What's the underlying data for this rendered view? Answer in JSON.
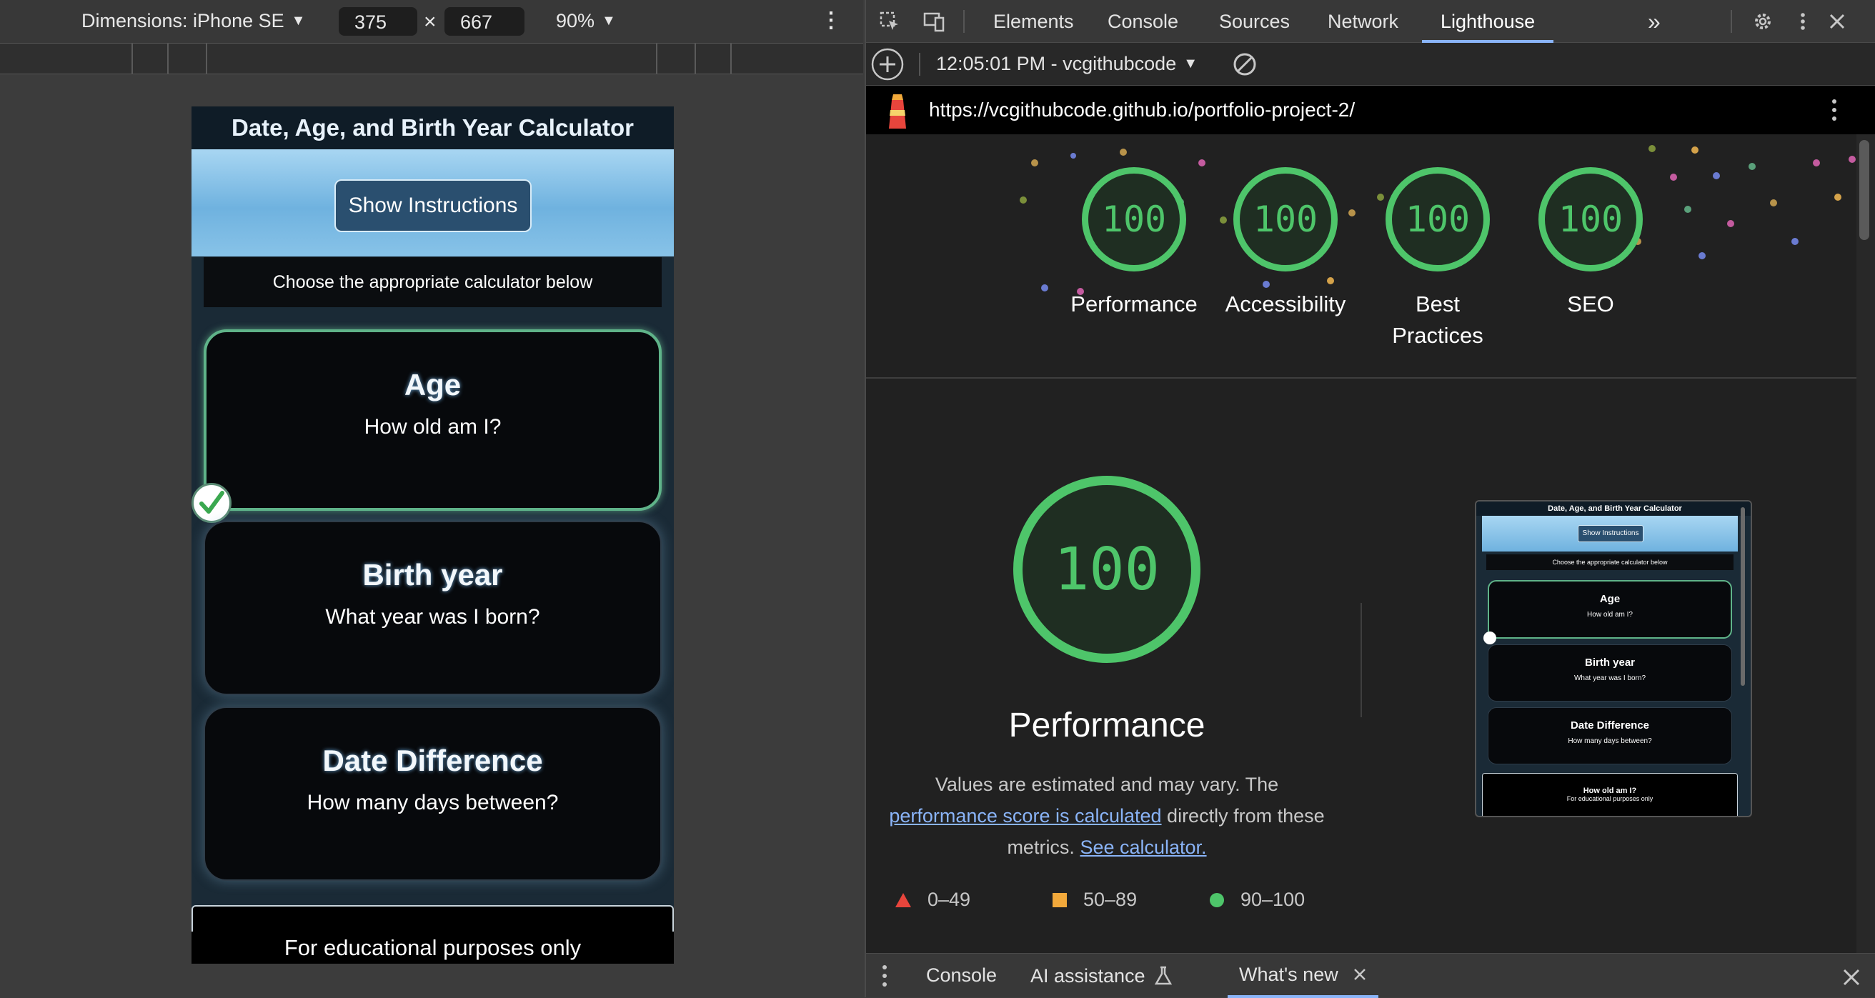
{
  "device_toolbar": {
    "dimensions_label": "Dimensions: iPhone SE",
    "width": "375",
    "height": "667",
    "times": "×",
    "zoom": "90%"
  },
  "app": {
    "title": "Date, Age, and Birth Year Calculator",
    "show_instructions": "Show Instructions",
    "choose_text": "Choose the appropriate calculator below",
    "cards": [
      {
        "title": "Age",
        "subtitle": "How old am I?"
      },
      {
        "title": "Birth year",
        "subtitle": "What year was I born?"
      },
      {
        "title": "Date Difference",
        "subtitle": "How many days between?"
      }
    ],
    "footer": "For educational purposes only"
  },
  "devtools": {
    "tabs": [
      "Elements",
      "Console",
      "Sources",
      "Network",
      "Lighthouse"
    ],
    "active_tab": "Lighthouse",
    "overflow": "»",
    "report_selector": "12:05:01 PM - vcgithubcode",
    "url": "https://vcgithubcode.github.io/portfolio-project-2/"
  },
  "lighthouse": {
    "scores": [
      {
        "label": "Performance",
        "score": "100"
      },
      {
        "label": "Accessibility",
        "score": "100"
      },
      {
        "label": "Best Practices",
        "score": "100"
      },
      {
        "label": "SEO",
        "score": "100"
      }
    ],
    "main_score": "100",
    "main_label": "Performance",
    "explain_prefix": "Values are estimated and may vary. The ",
    "explain_link1": "performance score is calculated",
    "explain_mid": " directly from these metrics. ",
    "explain_link2": "See calculator.",
    "legend": [
      {
        "range": "0–49",
        "color": "#e8453c"
      },
      {
        "range": "50–89",
        "color": "#f2a93b"
      },
      {
        "range": "90–100",
        "color": "#4ec56a"
      }
    ],
    "thumbnail": {
      "title": "Date, Age, and Birth Year Calculator",
      "button": "Show Instructions",
      "choose": "Choose the appropriate calculator below",
      "cards": [
        {
          "title": "Age",
          "subtitle": "How old am I?"
        },
        {
          "title": "Birth year",
          "subtitle": "What year was I born?"
        },
        {
          "title": "Date Difference",
          "subtitle": "How many days between?"
        }
      ],
      "footer_title": "How old am I?",
      "footer_sub": "For educational purposes only"
    }
  },
  "drawer": {
    "tabs": [
      "Console",
      "AI assistance",
      "What's new"
    ],
    "active_tab": "What's new"
  },
  "colors": {
    "accent_green": "#4ec56a",
    "link_blue": "#8ab4f8"
  }
}
